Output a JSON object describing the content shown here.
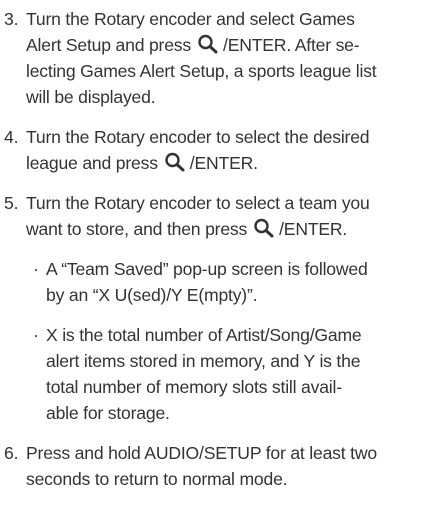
{
  "steps": [
    {
      "number": "3.",
      "lines": [
        "Turn the Rotary encoder and select Games",
        "Alert Setup and press",
        "/ENTER. After se-",
        "lecting Games Alert Setup, a sports league list",
        "will be displayed."
      ]
    },
    {
      "number": "4.",
      "lines": [
        "Turn the Rotary encoder to select the desired",
        "league and press",
        "/ENTER."
      ]
    },
    {
      "number": "5.",
      "lines": [
        "Turn the Rotary encoder to select a team you",
        "want to store, and then press",
        "/ENTER."
      ]
    },
    {
      "number": "6.",
      "lines": [
        "Press and hold AUDIO/SETUP for at least two",
        "seconds to return to normal mode."
      ]
    }
  ],
  "bullets": [
    {
      "symbol": "·",
      "lines": [
        "A “Team Saved” pop-up screen is followed",
        "by an “X U(sed)/Y E(mpty)”."
      ]
    },
    {
      "symbol": "·",
      "lines": [
        "X is the total number of Artist/Song/Game",
        "alert items stored in memory, and Y is the",
        "total number of memory slots still avail-",
        "able for storage."
      ]
    }
  ],
  "icons": {
    "search": "search-icon"
  }
}
